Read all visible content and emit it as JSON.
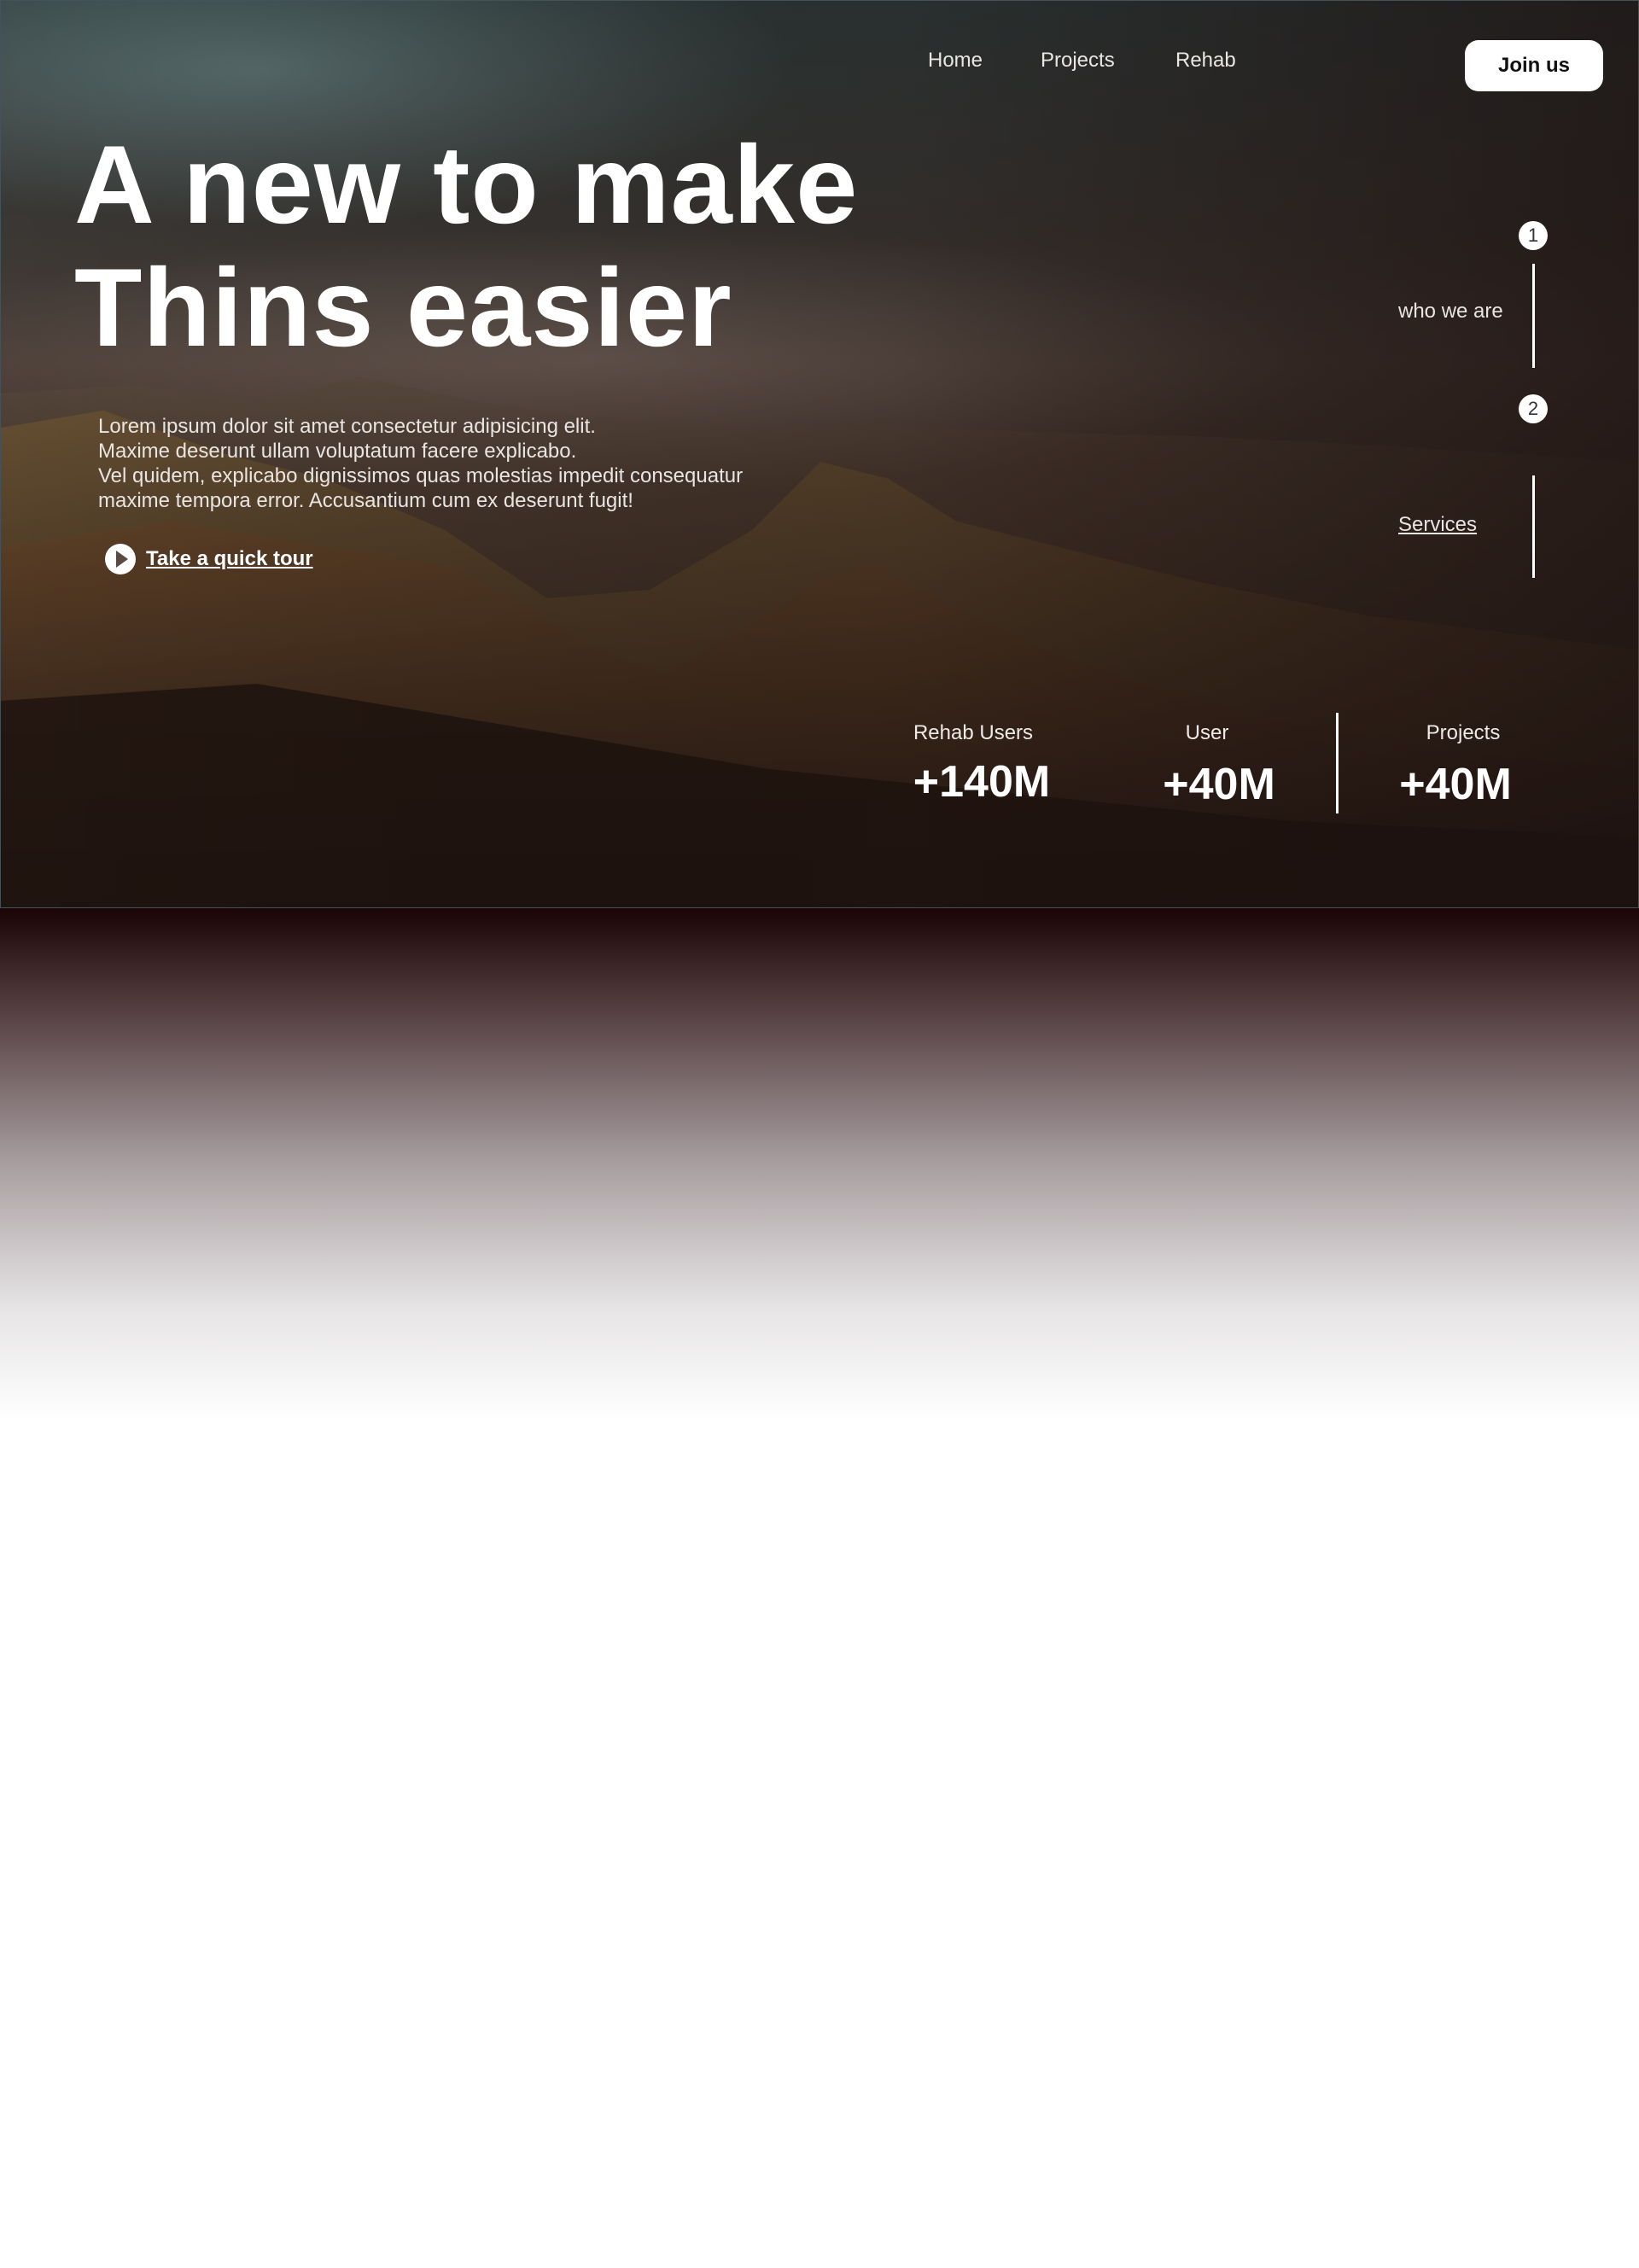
{
  "nav": {
    "items": [
      "Home",
      "Projects",
      "Rehab"
    ],
    "join_label": "Join us"
  },
  "hero": {
    "headline_line1": "A new to make",
    "headline_line2": "Thins easier",
    "paragraph": [
      "Lorem ipsum dolor sit amet consectetur adipisicing elit.",
      "Maxime deserunt ullam voluptatum facere explicabo.",
      "Vel quidem, explicabo dignissimos quas molestias impedit consequatur",
      "maxime tempora error. Accusantium cum ex deserunt fugit!"
    ],
    "tour_label": "Take a quick tour"
  },
  "steps": [
    {
      "number": "1",
      "label": "who we are"
    },
    {
      "number": "2",
      "label": "Services"
    }
  ],
  "stats": [
    {
      "label": "Rehab Users",
      "value": "+140M"
    },
    {
      "label": "User",
      "value": "+40M"
    },
    {
      "label": "Projects",
      "value": "+40M"
    }
  ]
}
